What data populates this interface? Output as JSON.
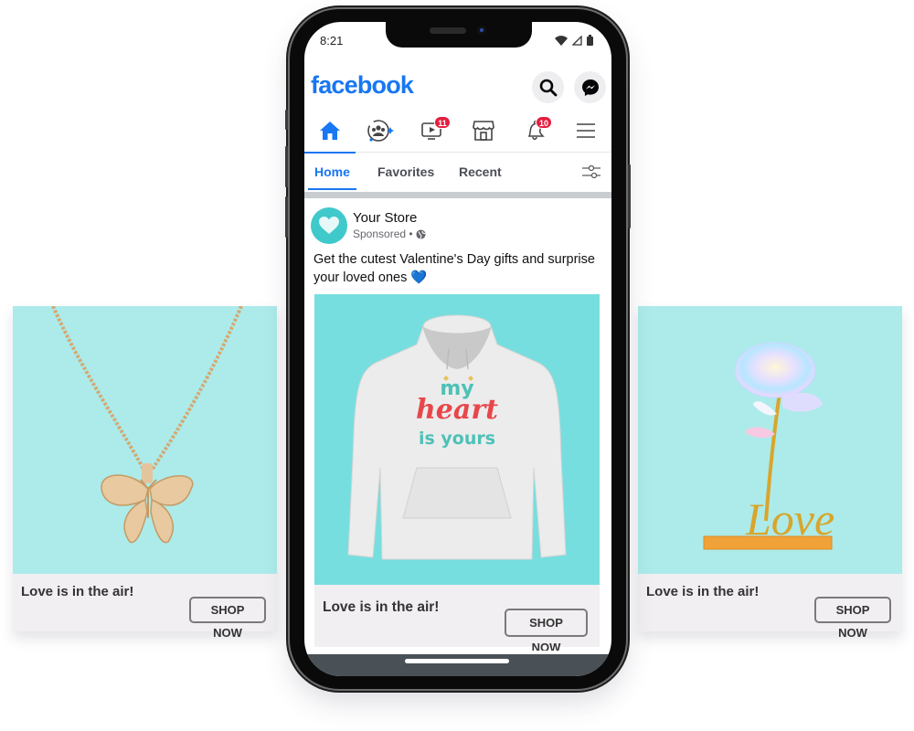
{
  "colors": {
    "brand": "#1877f2",
    "badge": "#e41e3f",
    "card_bg": "#acebea",
    "post_image_bg": "#77dedf",
    "avatar_bg": "#3fc9cb"
  },
  "status_bar": {
    "time": "8:21",
    "icons": [
      "wifi-icon",
      "signal-icon",
      "battery-icon"
    ]
  },
  "header": {
    "logo": "facebook",
    "buttons": [
      "search-icon",
      "messenger-icon"
    ]
  },
  "nav": {
    "items": [
      {
        "name": "home",
        "icon": "home-icon",
        "active": true,
        "badge": null
      },
      {
        "name": "groups",
        "icon": "groups-icon",
        "active": false,
        "badge": null
      },
      {
        "name": "watch",
        "icon": "video-icon",
        "active": false,
        "badge": "11"
      },
      {
        "name": "marketplace",
        "icon": "store-icon",
        "active": false,
        "badge": null
      },
      {
        "name": "notifications",
        "icon": "bell-icon",
        "active": false,
        "badge": "10"
      },
      {
        "name": "menu",
        "icon": "hamburger-icon",
        "active": false,
        "badge": null
      }
    ]
  },
  "feed_tabs": {
    "items": [
      {
        "label": "Home",
        "active": true
      },
      {
        "label": "Favorites",
        "active": false
      },
      {
        "label": "Recent",
        "active": false
      }
    ]
  },
  "post": {
    "author": "Your Store",
    "meta": "Sponsored •",
    "text": "Get the cutest Valentine's Day gifts and surprise your loved ones 💙",
    "image": {
      "product": "hoodie",
      "print_line1": "my",
      "print_line2": "heart",
      "print_line3": "is yours"
    },
    "caption": "Love is in the air!",
    "cta": "SHOP NOW"
  },
  "side_cards": [
    {
      "product": "butterfly necklace",
      "caption": "Love is in the air!",
      "cta": "SHOP NOW"
    },
    {
      "product": "galaxy rose with Love stand",
      "caption": "Love is in the air!",
      "cta": "SHOP NOW",
      "stand_text": "Love"
    }
  ]
}
